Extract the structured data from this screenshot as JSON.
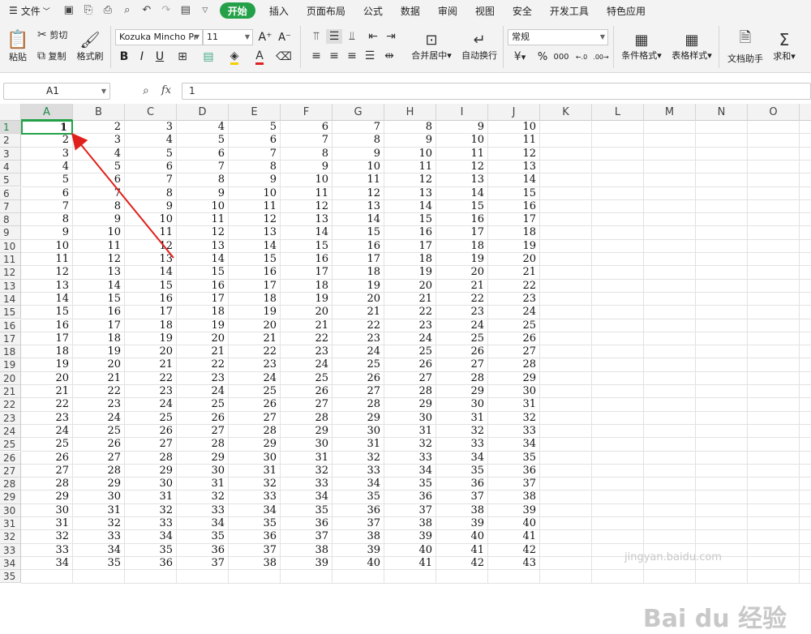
{
  "menu": {
    "file_label": "文件",
    "tabs": [
      "开始",
      "插入",
      "页面布局",
      "公式",
      "数据",
      "审阅",
      "视图",
      "安全",
      "开发工具",
      "特色应用"
    ]
  },
  "ribbon": {
    "paste": "粘贴",
    "cut": "剪切",
    "copy": "复制",
    "format_painter": "格式刷",
    "font_name": "Kozuka Mincho Pr",
    "font_size": "11",
    "merge_center": "合并居中",
    "wrap_text": "自动换行",
    "number_format": "常规",
    "cond_format": "条件格式",
    "table_style": "表格样式",
    "doc_helper": "文档助手",
    "sum": "求和",
    "bold": "B",
    "italic": "I",
    "underline": "U",
    "percent": "%",
    "thousands": "000",
    "fx": "fx"
  },
  "formula_bar": {
    "name_box": "A1",
    "content": "1"
  },
  "columns": [
    "A",
    "B",
    "C",
    "D",
    "E",
    "F",
    "G",
    "H",
    "I",
    "J",
    "K",
    "L",
    "M",
    "N",
    "O"
  ],
  "rows": [
    "1",
    "2",
    "3",
    "4",
    "5",
    "6",
    "7",
    "8",
    "9",
    "10",
    "11",
    "12",
    "13",
    "14",
    "15",
    "16",
    "17",
    "18",
    "19",
    "20",
    "21",
    "22",
    "23",
    "24",
    "25",
    "26",
    "27",
    "28",
    "29",
    "30",
    "31",
    "32",
    "33",
    "34",
    "35"
  ],
  "sheet_values": [
    [
      1,
      2,
      3,
      4,
      5,
      6,
      7,
      8,
      9,
      10
    ],
    [
      2,
      3,
      4,
      5,
      6,
      7,
      8,
      9,
      10,
      11
    ],
    [
      3,
      4,
      5,
      6,
      7,
      8,
      9,
      10,
      11,
      12
    ],
    [
      4,
      5,
      6,
      7,
      8,
      9,
      10,
      11,
      12,
      13
    ],
    [
      5,
      6,
      7,
      8,
      9,
      10,
      11,
      12,
      13,
      14
    ],
    [
      6,
      7,
      8,
      9,
      10,
      11,
      12,
      13,
      14,
      15
    ],
    [
      7,
      8,
      9,
      10,
      11,
      12,
      13,
      14,
      15,
      16
    ],
    [
      8,
      9,
      10,
      11,
      12,
      13,
      14,
      15,
      16,
      17
    ],
    [
      9,
      10,
      11,
      12,
      13,
      14,
      15,
      16,
      17,
      18
    ],
    [
      10,
      11,
      12,
      13,
      14,
      15,
      16,
      17,
      18,
      19
    ],
    [
      11,
      12,
      13,
      14,
      15,
      16,
      17,
      18,
      19,
      20
    ],
    [
      12,
      13,
      14,
      15,
      16,
      17,
      18,
      19,
      20,
      21
    ],
    [
      13,
      14,
      15,
      16,
      17,
      18,
      19,
      20,
      21,
      22
    ],
    [
      14,
      15,
      16,
      17,
      18,
      19,
      20,
      21,
      22,
      23
    ],
    [
      15,
      16,
      17,
      18,
      19,
      20,
      21,
      22,
      23,
      24
    ],
    [
      16,
      17,
      18,
      19,
      20,
      21,
      22,
      23,
      24,
      25
    ],
    [
      17,
      18,
      19,
      20,
      21,
      22,
      23,
      24,
      25,
      26
    ],
    [
      18,
      19,
      20,
      21,
      22,
      23,
      24,
      25,
      26,
      27
    ],
    [
      19,
      20,
      21,
      22,
      23,
      24,
      25,
      26,
      27,
      28
    ],
    [
      20,
      21,
      22,
      23,
      24,
      25,
      26,
      27,
      28,
      29
    ],
    [
      21,
      22,
      23,
      24,
      25,
      26,
      27,
      28,
      29,
      30
    ],
    [
      22,
      23,
      24,
      25,
      26,
      27,
      28,
      29,
      30,
      31
    ],
    [
      23,
      24,
      25,
      26,
      27,
      28,
      29,
      30,
      31,
      32
    ],
    [
      24,
      25,
      26,
      27,
      28,
      29,
      30,
      31,
      32,
      33
    ],
    [
      25,
      26,
      27,
      28,
      29,
      30,
      31,
      32,
      33,
      34
    ],
    [
      26,
      27,
      28,
      29,
      30,
      31,
      32,
      33,
      34,
      35
    ],
    [
      27,
      28,
      29,
      30,
      31,
      32,
      33,
      34,
      35,
      36
    ],
    [
      28,
      29,
      30,
      31,
      32,
      33,
      34,
      35,
      36,
      37
    ],
    [
      29,
      30,
      31,
      32,
      33,
      34,
      35,
      36,
      37,
      38
    ],
    [
      30,
      31,
      32,
      33,
      34,
      35,
      36,
      37,
      38,
      39
    ],
    [
      31,
      32,
      33,
      34,
      35,
      36,
      37,
      38,
      39,
      40
    ],
    [
      32,
      33,
      34,
      35,
      36,
      37,
      38,
      39,
      40,
      41
    ],
    [
      33,
      34,
      35,
      36,
      37,
      38,
      39,
      40,
      41,
      42
    ],
    [
      34,
      35,
      36,
      37,
      38,
      39,
      40,
      41,
      42,
      43
    ]
  ],
  "selected_cell": "A1",
  "watermark": {
    "brand": "Bai du 经验",
    "url": "jingyan.baidu.com"
  },
  "colors": {
    "accent": "#24a148",
    "arrow": "#e0201c"
  }
}
